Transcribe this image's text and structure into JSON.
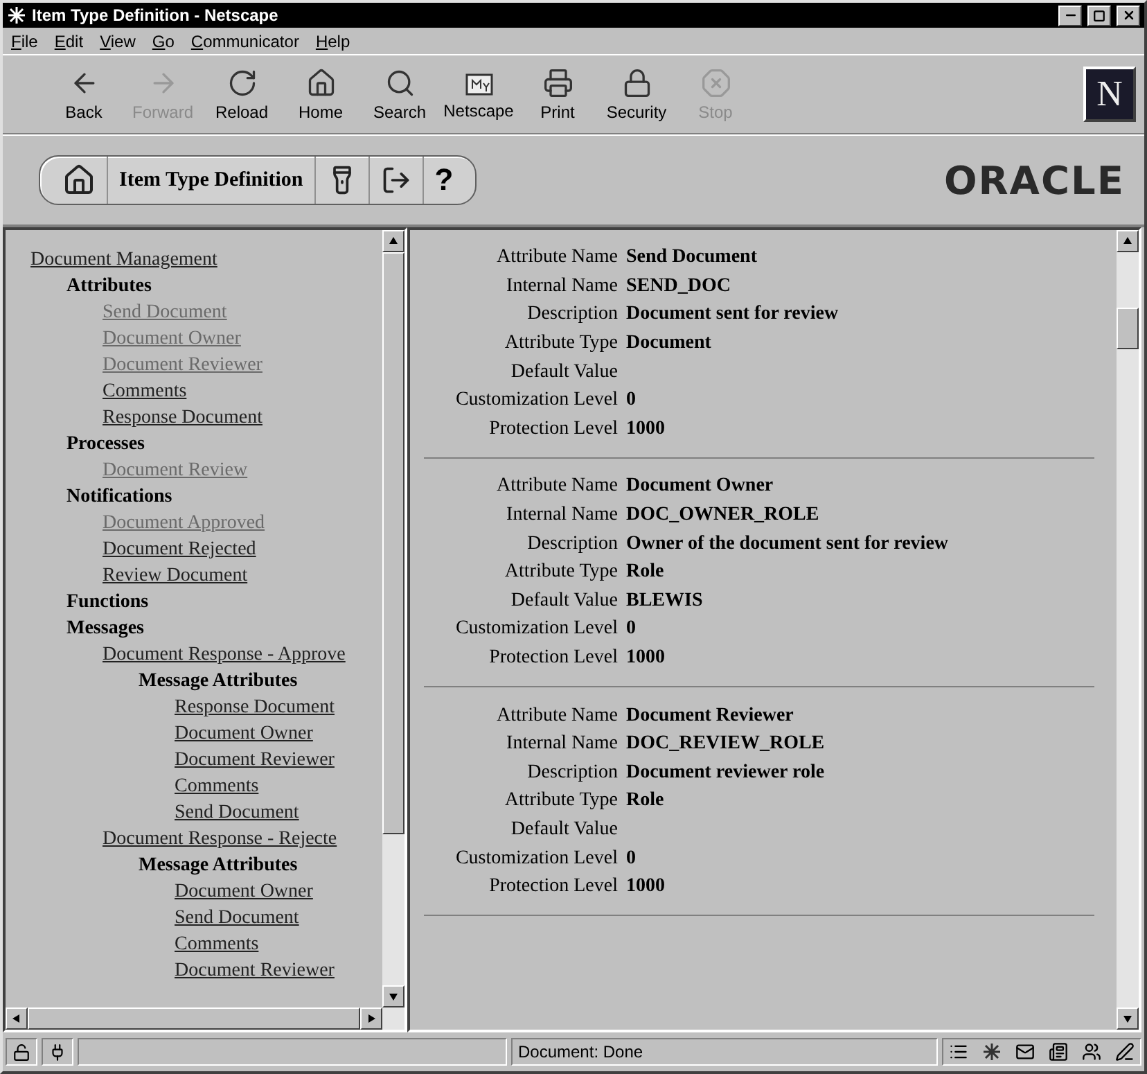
{
  "window": {
    "title": "Item Type Definition - Netscape"
  },
  "menu": [
    "File",
    "Edit",
    "View",
    "Go",
    "Communicator",
    "Help"
  ],
  "toolbar": [
    {
      "label": "Back",
      "kind": "back",
      "disabled": false
    },
    {
      "label": "Forward",
      "kind": "forward",
      "disabled": true
    },
    {
      "label": "Reload",
      "kind": "reload",
      "disabled": false
    },
    {
      "label": "Home",
      "kind": "home",
      "disabled": false
    },
    {
      "label": "Search",
      "kind": "search",
      "disabled": false
    },
    {
      "label": "Netscape",
      "kind": "netscape",
      "disabled": false
    },
    {
      "label": "Print",
      "kind": "print",
      "disabled": false
    },
    {
      "label": "Security",
      "kind": "security",
      "disabled": false
    },
    {
      "label": "Stop",
      "kind": "stop",
      "disabled": true
    }
  ],
  "browser_logo": "N",
  "header": {
    "title": "Item Type Definition",
    "help": "?",
    "logo": "ORACLE"
  },
  "tree": [
    {
      "label": "Document Management",
      "kind": "link",
      "visited": false,
      "children": [
        {
          "label": "Attributes",
          "kind": "heading",
          "children": [
            {
              "label": "Send Document",
              "kind": "link",
              "visited": true
            },
            {
              "label": "Document Owner",
              "kind": "link",
              "visited": true
            },
            {
              "label": "Document Reviewer",
              "kind": "link",
              "visited": true
            },
            {
              "label": "Comments",
              "kind": "link",
              "visited": false
            },
            {
              "label": "Response Document",
              "kind": "link",
              "visited": false
            }
          ]
        },
        {
          "label": "Processes",
          "kind": "heading",
          "children": [
            {
              "label": "Document Review",
              "kind": "link",
              "visited": true
            }
          ]
        },
        {
          "label": "Notifications",
          "kind": "heading",
          "children": [
            {
              "label": "Document Approved",
              "kind": "link",
              "visited": true
            },
            {
              "label": "Document Rejected",
              "kind": "link",
              "visited": false
            },
            {
              "label": "Review Document",
              "kind": "link",
              "visited": false
            }
          ]
        },
        {
          "label": "Functions",
          "kind": "heading"
        },
        {
          "label": "Messages",
          "kind": "heading",
          "children": [
            {
              "label": "Document Response - Approve",
              "kind": "link",
              "visited": false,
              "children": [
                {
                  "label": "Message Attributes",
                  "kind": "heading",
                  "children": [
                    {
                      "label": "Response Document",
                      "kind": "link",
                      "visited": false
                    },
                    {
                      "label": "Document Owner",
                      "kind": "link",
                      "visited": false
                    },
                    {
                      "label": "Document Reviewer",
                      "kind": "link",
                      "visited": false
                    },
                    {
                      "label": "Comments",
                      "kind": "link",
                      "visited": false
                    },
                    {
                      "label": "Send Document",
                      "kind": "link",
                      "visited": false
                    }
                  ]
                }
              ]
            },
            {
              "label": "Document Response - Rejecte",
              "kind": "link",
              "visited": false,
              "children": [
                {
                  "label": "Message Attributes",
                  "kind": "heading",
                  "children": [
                    {
                      "label": "Document Owner",
                      "kind": "link",
                      "visited": false
                    },
                    {
                      "label": "Send Document",
                      "kind": "link",
                      "visited": false
                    },
                    {
                      "label": "Comments",
                      "kind": "link",
                      "visited": false
                    },
                    {
                      "label": "Document Reviewer",
                      "kind": "link",
                      "visited": false
                    }
                  ]
                }
              ]
            }
          ]
        }
      ]
    }
  ],
  "attributes": [
    {
      "rows": [
        {
          "label": "Attribute Name",
          "value": "Send Document"
        },
        {
          "label": "Internal Name",
          "value": "SEND_DOC"
        },
        {
          "label": "Description",
          "value": "Document sent for review"
        },
        {
          "label": "Attribute Type",
          "value": "Document"
        },
        {
          "label": "Default Value"
        },
        {
          "label": "Customization Level",
          "value": "0"
        },
        {
          "label": "Protection Level",
          "value": "1000"
        }
      ]
    },
    {
      "rows": [
        {
          "label": "Attribute Name",
          "value": "Document Owner"
        },
        {
          "label": "Internal Name",
          "value": "DOC_OWNER_ROLE"
        },
        {
          "label": "Description",
          "value": "Owner of the document sent for review"
        },
        {
          "label": "Attribute Type",
          "value": "Role"
        },
        {
          "label": "Default Value",
          "value": "BLEWIS"
        },
        {
          "label": "Customization Level",
          "value": "0"
        },
        {
          "label": "Protection Level",
          "value": "1000"
        }
      ]
    },
    {
      "rows": [
        {
          "label": "Attribute Name",
          "value": "Document Reviewer"
        },
        {
          "label": "Internal Name",
          "value": "DOC_REVIEW_ROLE"
        },
        {
          "label": "Description",
          "value": "Document reviewer role"
        },
        {
          "label": "Attribute Type",
          "value": "Role"
        },
        {
          "label": "Default Value"
        },
        {
          "label": "Customization Level",
          "value": "0"
        },
        {
          "label": "Protection Level",
          "value": "1000"
        }
      ]
    }
  ],
  "status_bar": {
    "text": "Document: Done"
  }
}
